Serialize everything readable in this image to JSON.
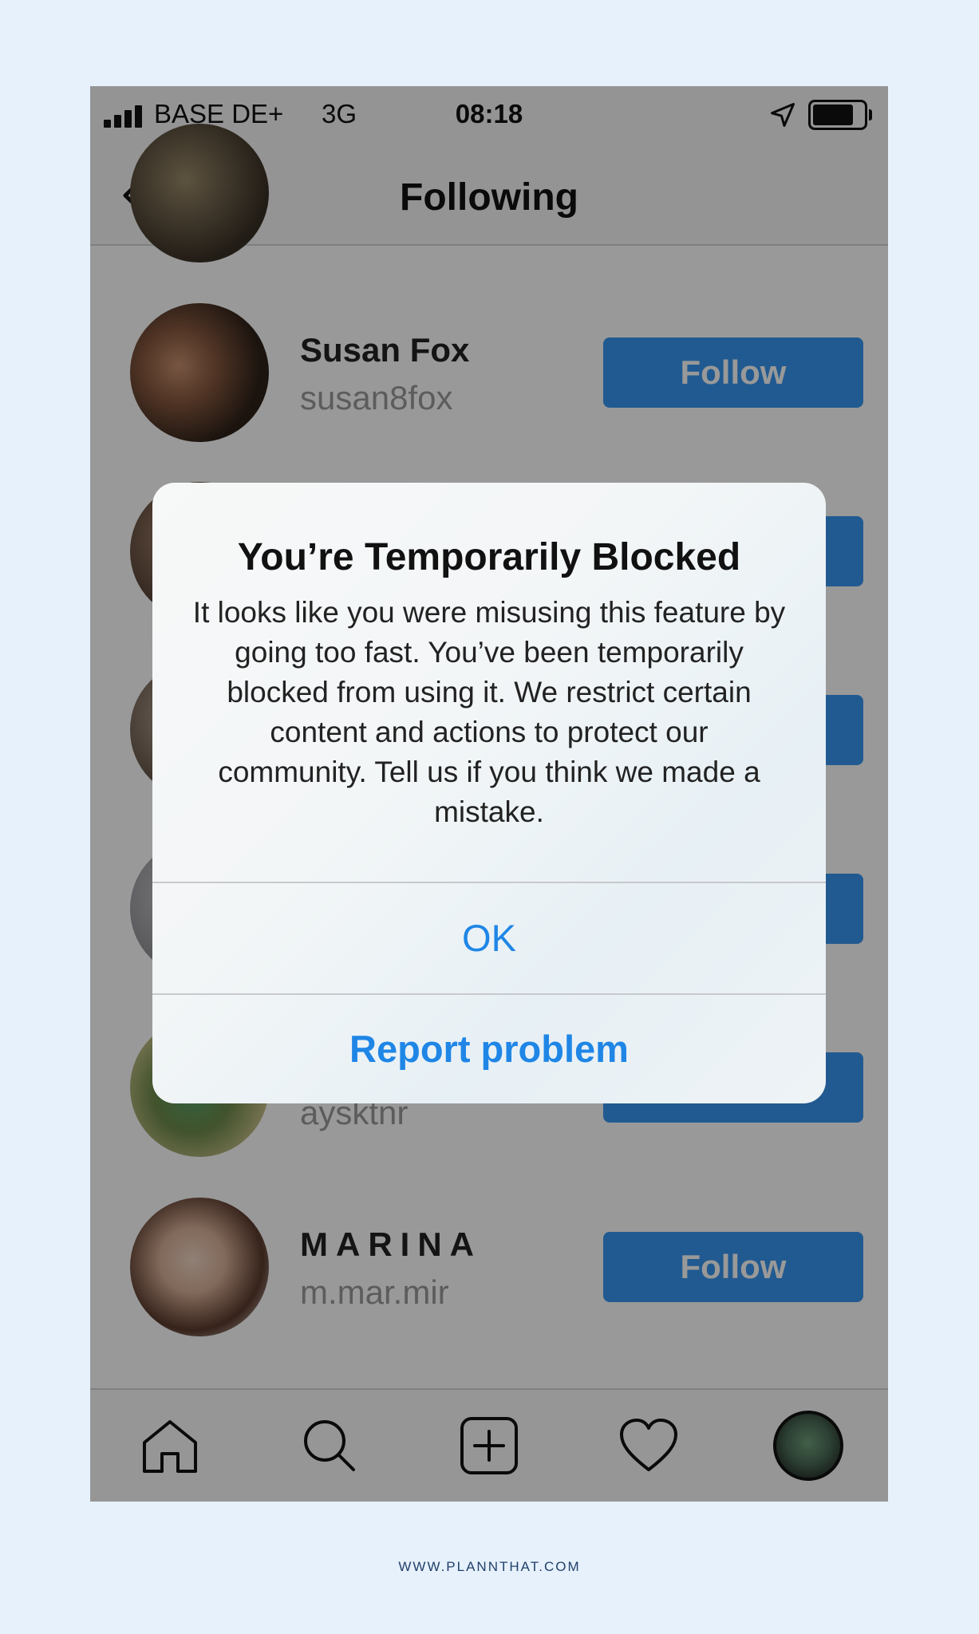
{
  "status_bar": {
    "carrier": "BASE DE+",
    "network": "3G",
    "time": "08:18",
    "signal_bars": 4,
    "icons": [
      "signal-icon",
      "location-arrow-icon",
      "battery-icon"
    ]
  },
  "nav": {
    "title": "Following",
    "back_icon": "chevron-left-icon"
  },
  "list": {
    "rows": [
      {
        "name": "",
        "handle": "",
        "button": ""
      },
      {
        "name": "Susan Fox",
        "handle": "susan8fox",
        "button": "Follow"
      },
      {
        "name": "",
        "handle": "",
        "button": ""
      },
      {
        "name": "",
        "handle": "",
        "button": ""
      },
      {
        "name": "",
        "handle": "",
        "button": ""
      },
      {
        "name": "",
        "handle": "aysktnr",
        "button": "Follow"
      },
      {
        "name": "MARINA",
        "handle": "m.mar.mir",
        "button": "Follow"
      }
    ]
  },
  "alert": {
    "title": "You’re Temporarily Blocked",
    "message": "It looks like you were misusing this feature by going too fast. You’ve been temporarily blocked from using it. We restrict certain content and actions to protect our community. Tell us if you think we made a mistake.",
    "ok_label": "OK",
    "report_label": "Report problem"
  },
  "tab_bar": {
    "items": [
      "home-icon",
      "search-icon",
      "add-post-icon",
      "heart-icon",
      "profile-avatar"
    ]
  },
  "colors": {
    "background": "#e6f1fc",
    "follow_button": "#3897f0",
    "alert_action": "#1f86e6",
    "footer_text": "#22406a"
  },
  "footer": {
    "url": "WWW.PLANNTHAT.COM"
  }
}
